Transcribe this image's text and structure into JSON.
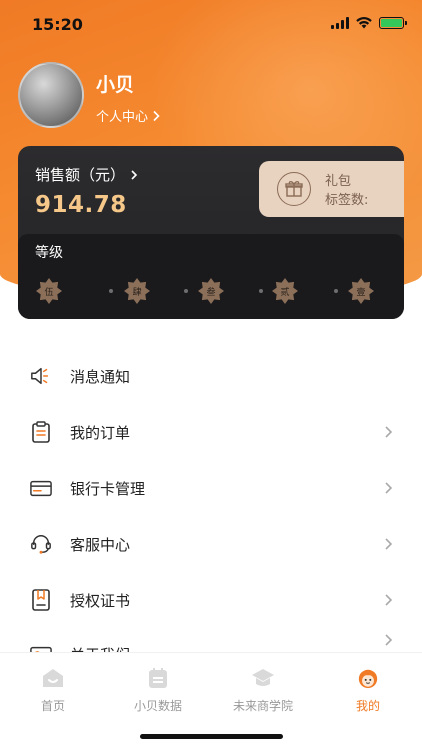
{
  "status_bar": {
    "time": "15:20"
  },
  "profile": {
    "name": "小贝",
    "center_link": "个人中心"
  },
  "sales": {
    "title": "销售额（元）",
    "value": "914.78"
  },
  "gift": {
    "label": "礼包",
    "count_label": "标签数:"
  },
  "level": {
    "title": "等级",
    "badges": [
      "伍",
      "肆",
      "叁",
      "贰",
      "壹"
    ]
  },
  "menu": {
    "items": [
      {
        "label": "消息通知",
        "icon": "speaker-icon",
        "arrow": false
      },
      {
        "label": "我的订单",
        "icon": "order-list-icon",
        "arrow": true
      },
      {
        "label": "银行卡管理",
        "icon": "bank-card-icon",
        "arrow": true
      },
      {
        "label": "客服中心",
        "icon": "headset-icon",
        "arrow": true
      },
      {
        "label": "授权证书",
        "icon": "certificate-icon",
        "arrow": true
      },
      {
        "label": "关于我们",
        "icon": "about-icon",
        "arrow": true
      }
    ]
  },
  "tabbar": {
    "tabs": [
      {
        "label": "首页",
        "icon": "home-icon"
      },
      {
        "label": "小贝数据",
        "icon": "calendar-data-icon"
      },
      {
        "label": "未来商学院",
        "icon": "graduation-cap-icon"
      },
      {
        "label": "我的",
        "icon": "profile-mascot-icon",
        "active": true
      }
    ]
  },
  "colors": {
    "accent": "#f07a25",
    "gold": "#f5c88a",
    "card_dark": "#2c2b2e",
    "gift_bg": "#e8d2c0",
    "badge": "#8b6f59",
    "battery": "#34c759"
  }
}
